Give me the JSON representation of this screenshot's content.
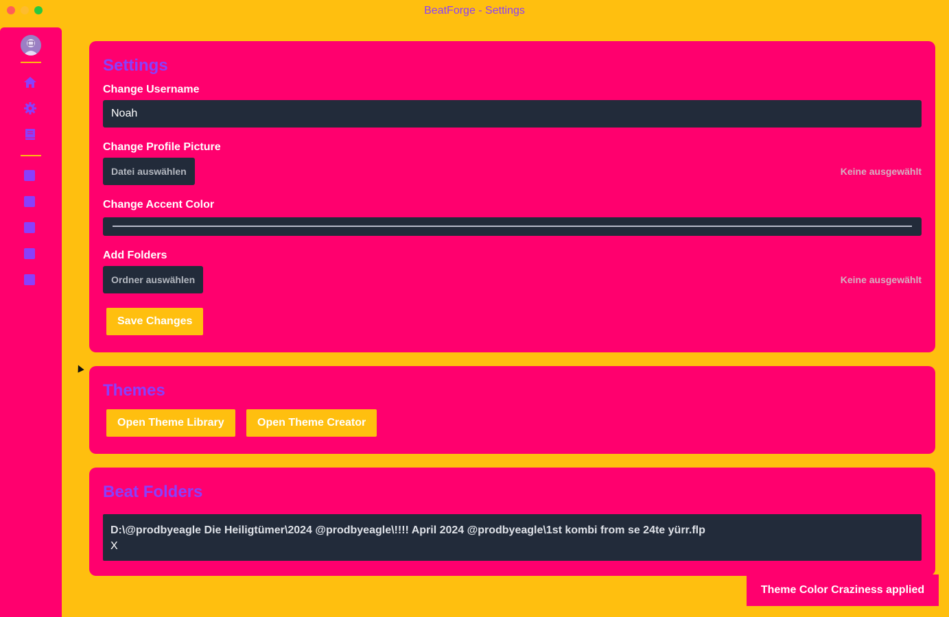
{
  "window": {
    "title": "BeatForge - Settings"
  },
  "sidebar": {
    "items": [
      {
        "icon": "home-icon"
      },
      {
        "icon": "gear-icon"
      },
      {
        "icon": "book-icon"
      }
    ],
    "folder_squares": 5,
    "accent": "#8a3ffc"
  },
  "settings": {
    "title": "Settings",
    "username_label": "Change Username",
    "username_value": "Noah",
    "picture_label": "Change Profile Picture",
    "picture_button": "Datei auswählen",
    "picture_status": "Keine ausgewählt",
    "accent_label": "Change Accent Color",
    "folders_label": "Add Folders",
    "folders_button": "Ordner auswählen",
    "folders_status": "Keine ausgewählt",
    "save_button": "Save Changes"
  },
  "themes": {
    "title": "Themes",
    "library_button": "Open Theme Library",
    "creator_button": "Open Theme Creator"
  },
  "beat_folders": {
    "title": "Beat Folders",
    "items": [
      {
        "path": "D:\\@prodbyeagle Die Heiligtümer\\2024 @prodbyeagle\\!!!! April 2024 @prodbyeagle\\1st kombi from se 24te yürr.flp",
        "remove": "X"
      }
    ]
  },
  "toast": {
    "message": "Theme Color Craziness applied"
  },
  "colors": {
    "background": "#ffbf0f",
    "card": "#ff006e",
    "heading": "#8a3ffc",
    "input": "#222b3a"
  }
}
